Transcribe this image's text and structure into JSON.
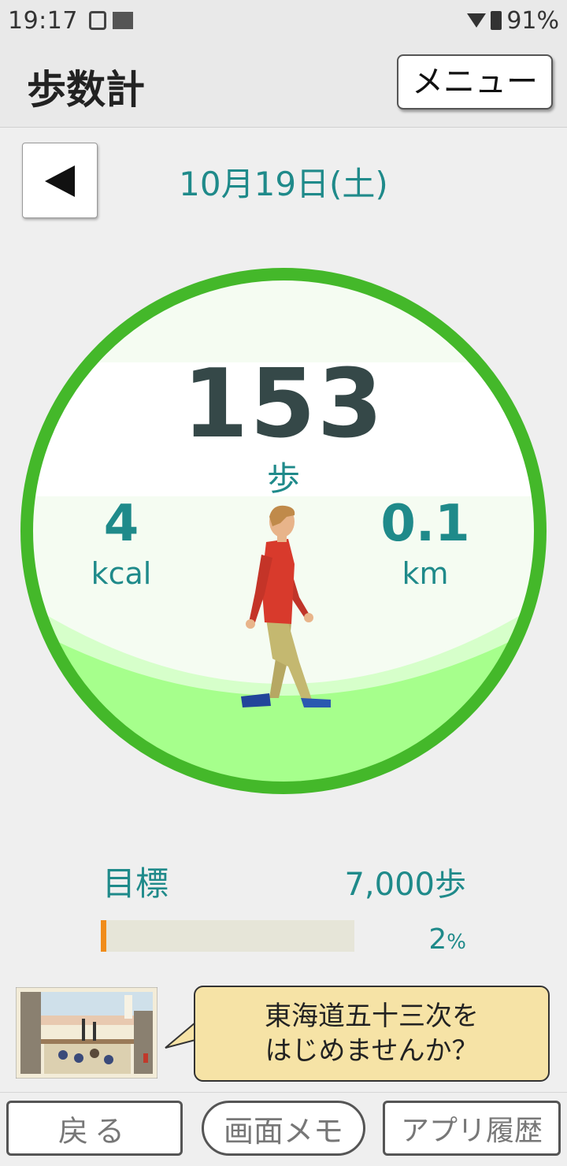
{
  "status_bar": {
    "time": "19:17",
    "battery": "91%"
  },
  "header": {
    "title": "歩数計",
    "menu_label": "メニュー"
  },
  "date": {
    "label": "10月19日(土)"
  },
  "stats": {
    "steps": "153",
    "steps_unit": "歩",
    "kcal": "4",
    "kcal_unit": "kcal",
    "km": "0.1",
    "km_unit": "km"
  },
  "goal": {
    "label": "目標",
    "value": "7,000歩",
    "percent": "2",
    "percent_unit": "%",
    "progress_fraction": 0.02
  },
  "promo": {
    "line1": "東海道五十三次を",
    "line2": "はじめませんか？"
  },
  "bottom_nav": {
    "back": "戻る",
    "memo": "画面メモ",
    "history": "アプリ履歴"
  },
  "colors": {
    "accent": "#1f8a8a",
    "ring": "#44b82a",
    "ground": "#a8ff8c",
    "progress": "#f08c1a"
  }
}
